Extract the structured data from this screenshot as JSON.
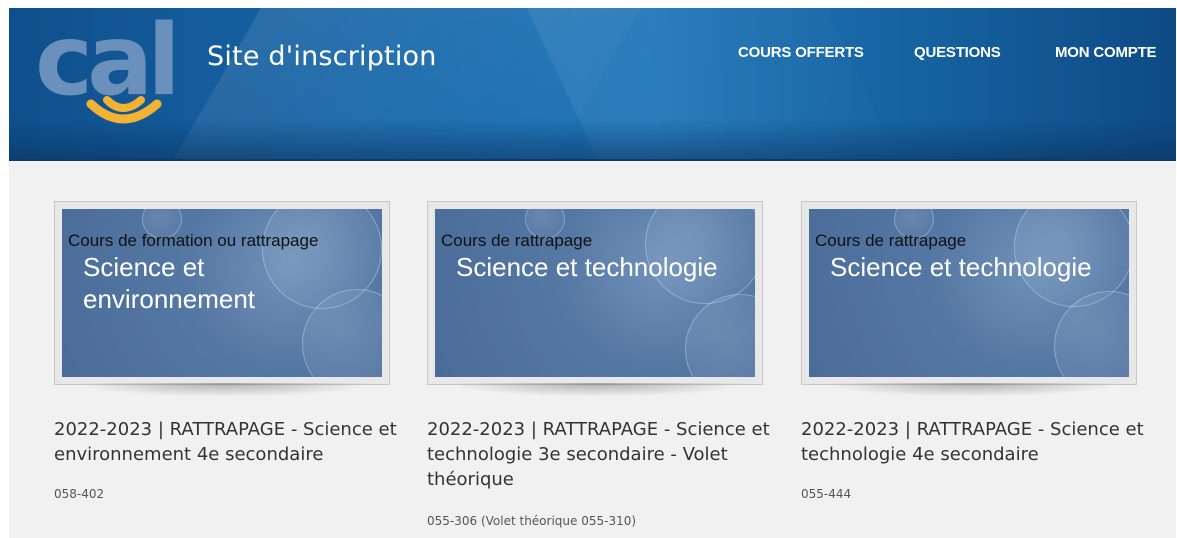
{
  "header": {
    "logo_text": "cal",
    "site_title": "Site d'inscription",
    "nav": {
      "courses": "COURS OFFERTS",
      "questions": "QUESTIONS",
      "account": "MON COMPTE"
    }
  },
  "courses": [
    {
      "thumb_small": "Cours de formation ou rattrapage",
      "thumb_big": "Science et environnement",
      "title": "2022-2023 | RATTRAPAGE - Science et environnement 4e secondaire",
      "code": "058-402"
    },
    {
      "thumb_small": "Cours de rattrapage",
      "thumb_big": "Science et technologie",
      "title": "2022-2023 | RATTRAPAGE - Science et technologie 3e secondaire - Volet théorique",
      "code": "055-306 (Volet théorique 055-310)"
    },
    {
      "thumb_small": "Cours de rattrapage",
      "thumb_big": "Science et technologie",
      "title": "2022-2023 | RATTRAPAGE - Science et technologie 4e secondaire",
      "code": "055-444"
    }
  ],
  "colors": {
    "header_blue": "#1766a8",
    "logo_blue": "#6b90bb",
    "logo_yellow": "#f2b233",
    "thumb_blue": "#5577a3"
  }
}
